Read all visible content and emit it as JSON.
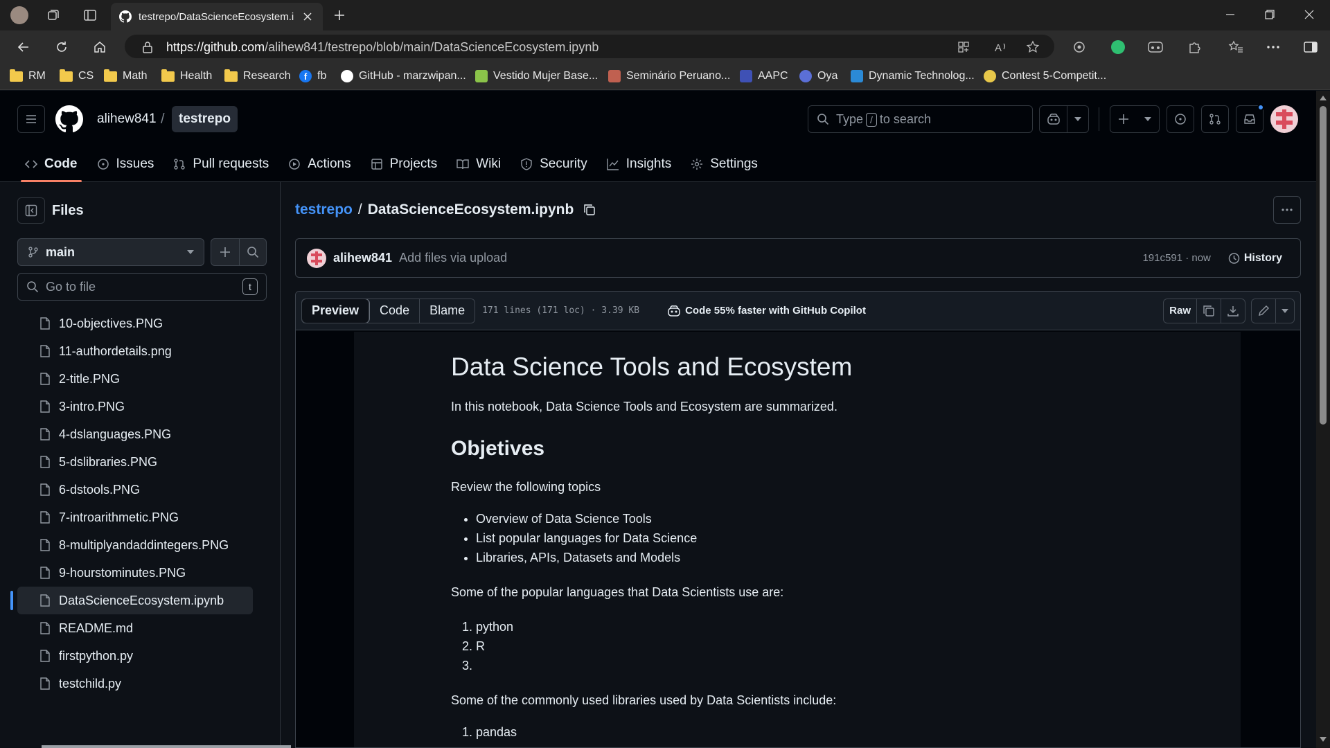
{
  "browser": {
    "tab_title": "testrepo/DataScienceEcosystem.ipynb",
    "url_host": "https://github.com",
    "url_path": "/alihew841/testrepo/blob/main/DataScienceEcosystem.ipynb"
  },
  "bookmarks": [
    {
      "label": "RM",
      "icon": "folder-icon"
    },
    {
      "label": "CS",
      "icon": "folder-icon"
    },
    {
      "label": "Math",
      "icon": "folder-icon"
    },
    {
      "label": "Health",
      "icon": "folder-icon"
    },
    {
      "label": "Research",
      "icon": "folder-icon"
    },
    {
      "label": "fb",
      "icon": "facebook-icon"
    },
    {
      "label": "GitHub - marzwipan...",
      "icon": "github-icon"
    },
    {
      "label": "Vestido Mujer Base...",
      "icon": "site-icon"
    },
    {
      "label": "Seminário Peruano...",
      "icon": "site-icon"
    },
    {
      "label": "AAPC",
      "icon": "site-icon"
    },
    {
      "label": "Oya",
      "icon": "site-icon"
    },
    {
      "label": "Dynamic Technolog...",
      "icon": "site-icon"
    },
    {
      "label": "Contest 5-Competit...",
      "icon": "site-icon"
    }
  ],
  "header": {
    "owner": "alihew841",
    "slash": "/",
    "repo": "testrepo",
    "search_pre": "Type",
    "search_key": "/",
    "search_post": "to search"
  },
  "tabs": [
    {
      "label": "Code",
      "icon": "code-icon"
    },
    {
      "label": "Issues",
      "icon": "issue-icon"
    },
    {
      "label": "Pull requests",
      "icon": "pull-request-icon"
    },
    {
      "label": "Actions",
      "icon": "play-icon"
    },
    {
      "label": "Projects",
      "icon": "table-icon"
    },
    {
      "label": "Wiki",
      "icon": "book-icon"
    },
    {
      "label": "Security",
      "icon": "shield-icon"
    },
    {
      "label": "Insights",
      "icon": "graph-icon"
    },
    {
      "label": "Settings",
      "icon": "gear-icon"
    }
  ],
  "sidebar": {
    "title": "Files",
    "branch": "main",
    "goto_placeholder": "Go to file",
    "goto_key": "t",
    "files": [
      "10-objectives.PNG",
      "11-authordetails.png",
      "2-title.PNG",
      "3-intro.PNG",
      "4-dslanguages.PNG",
      "5-dslibraries.PNG",
      "6-dstools.PNG",
      "7-introarithmetic.PNG",
      "8-multiplyandaddintegers.PNG",
      "9-hourstominutes.PNG",
      "DataScienceEcosystem.ipynb",
      "README.md",
      "firstpython.py",
      "testchild.py"
    ],
    "active_file": "DataScienceEcosystem.ipynb"
  },
  "main": {
    "crumb_repo": "testrepo",
    "crumb_sep": "/",
    "crumb_file": "DataScienceEcosystem.ipynb",
    "commit_author": "alihew841",
    "commit_msg": "Add files via upload",
    "commit_info": "191c591 · now",
    "history_label": "History",
    "view_preview": "Preview",
    "view_code": "Code",
    "view_blame": "Blame",
    "file_meta": "171 lines (171 loc) · 3.39 KB",
    "copilot_label": "Code 55% faster with GitHub Copilot",
    "raw_label": "Raw"
  },
  "notebook": {
    "title": "Data Science Tools and Ecosystem",
    "intro": "In this notebook, Data Science Tools and Ecosystem are summarized.",
    "h2": "Objetives",
    "review": "Review the following topics",
    "objectives": [
      "Overview of Data Science Tools",
      "List popular languages for Data Science",
      "Libraries, APIs, Datasets and Models"
    ],
    "languages_intro": "Some of the popular languages that Data Scientists use are:",
    "languages": [
      "python",
      "R",
      ""
    ],
    "libraries_intro": "Some of the commonly used libraries used by Data Scientists include:",
    "libraries": [
      "pandas"
    ]
  },
  "colors": {
    "accent": "#4493f8",
    "tab_underline": "#f78166",
    "bg": "#0d1117"
  }
}
